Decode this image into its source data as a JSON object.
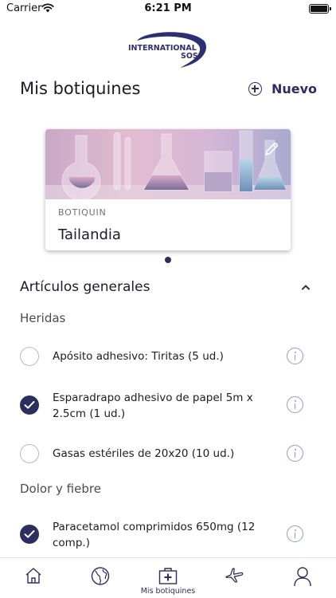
{
  "status_bar": {
    "carrier": "Carrier",
    "time": "6:21 PM"
  },
  "logo": {
    "line1": "INTERNATIONAL",
    "line2": "SOS"
  },
  "header": {
    "title": "Mis botiquines",
    "new_label": "Nuevo"
  },
  "kit_card": {
    "kicker": "BOTIQUIN",
    "name": "Tailandia"
  },
  "section": {
    "title": "Artículos generales"
  },
  "categories": [
    "Heridas",
    "Dolor y fiebre"
  ],
  "items": [
    {
      "label": "Apósito adhesivo: Tiritas (5 ud.)",
      "checked": false
    },
    {
      "label": "Esparadrapo adhesivo de papel 5m x 2.5cm (1 ud.)",
      "checked": true
    },
    {
      "label": "Gasas estériles de 20x20 (10 ud.)",
      "checked": false
    },
    {
      "label": "Paracetamol comprimidos 650mg (12 comp.)",
      "checked": true
    }
  ],
  "tab_bar": {
    "active_label": "Mis botiquines",
    "tabs": [
      "home-icon",
      "globe-icon",
      "first-aid-kit-icon",
      "airplane-icon",
      "user-icon"
    ]
  },
  "colors": {
    "accent": "#2d2e5e",
    "info": "#8e9ec8",
    "unchecked": "#b9b9c0"
  }
}
